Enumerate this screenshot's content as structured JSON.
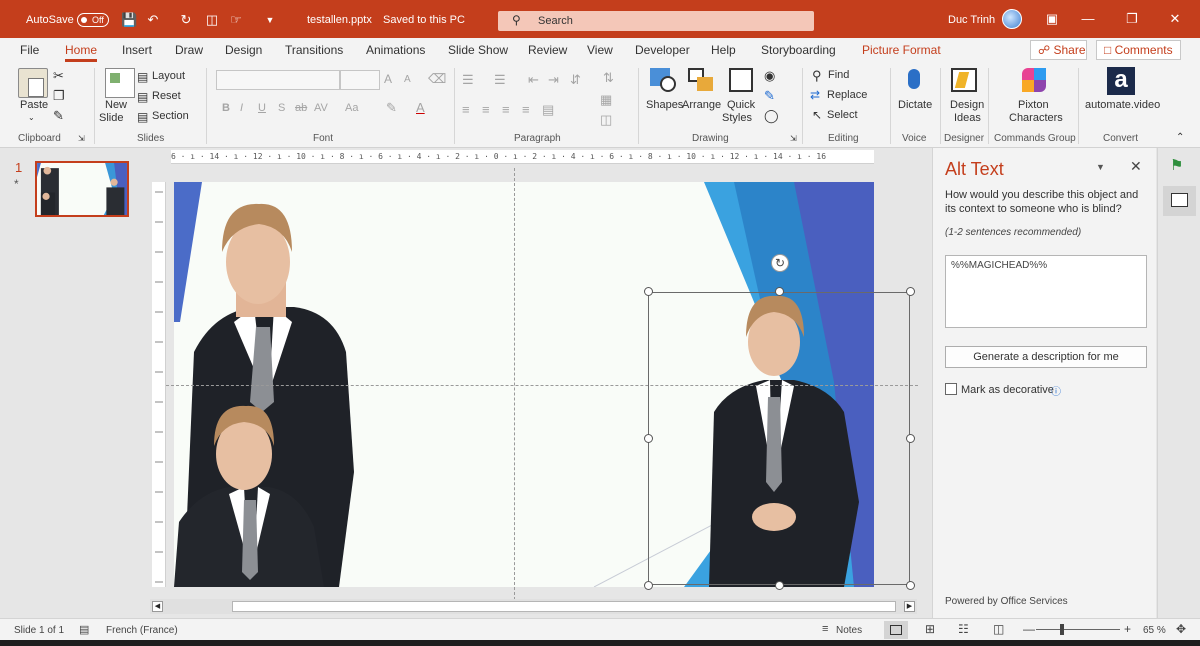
{
  "titlebar": {
    "autosave_label": "AutoSave",
    "toggle_state": "Off",
    "filename": "testallen.pptx",
    "save_status": "Saved to this PC",
    "search_placeholder": "Search",
    "user_name": "Duc Trinh",
    "accent": "#c43e1c"
  },
  "tabs": [
    "File",
    "Home",
    "Insert",
    "Draw",
    "Design",
    "Transitions",
    "Animations",
    "Slide Show",
    "Review",
    "View",
    "Developer",
    "Help",
    "Storyboarding",
    "Picture Format"
  ],
  "active_tab": "Home",
  "share": {
    "share_label": "Share",
    "comments_label": "Comments"
  },
  "ribbon": {
    "clipboard": {
      "paste": "Paste",
      "group": "Clipboard"
    },
    "slides": {
      "new_slide_1": "New",
      "new_slide_2": "Slide",
      "layout": "Layout",
      "reset": "Reset",
      "section": "Section",
      "group": "Slides"
    },
    "font": {
      "group": "Font",
      "bold": "B",
      "italic": "I",
      "underline": "U",
      "shadow": "S",
      "strike": "ab",
      "spacing": "AV",
      "case": "Aa",
      "grow": "A",
      "shrink": "A"
    },
    "paragraph": {
      "group": "Paragraph"
    },
    "drawing": {
      "shapes": "Shapes",
      "arrange": "Arrange",
      "quick_styles_1": "Quick",
      "quick_styles_2": "Styles",
      "group": "Drawing"
    },
    "editing": {
      "find": "Find",
      "replace": "Replace",
      "select": "Select",
      "group": "Editing"
    },
    "voice": {
      "dictate": "Dictate",
      "group": "Voice"
    },
    "designer": {
      "design_ideas_1": "Design",
      "design_ideas_2": "Ideas",
      "group": "Designer"
    },
    "commands": {
      "pixton_1": "Pixton",
      "pixton_2": "Characters",
      "group": "Commands Group"
    },
    "convert": {
      "automate": "automate.video",
      "group": "Convert"
    }
  },
  "slides_panel": {
    "slide_number": "1",
    "star": "*"
  },
  "ruler": {
    "horizontal": "6 · ı · 14 · ı · 12 · ı · 10 · ı · 8 · ı · 6 · ı · 4 · ı · 2 · ı · 0 · ı · 2 · ı · 4 · ı · 6 · ı · 8 · ı · 10 · ı · 12 · ı · 14 · ı · 16"
  },
  "alt_text": {
    "title": "Alt Text",
    "prompt": "How would you describe this object and its context to someone who is blind?",
    "hint": "(1-2 sentences recommended)",
    "value": "%%MAGICHEAD%%",
    "generate_btn": "Generate a description for me",
    "decorative_label": "Mark as decorative",
    "powered_by": "Powered by Office Services"
  },
  "status": {
    "slide_info": "Slide 1 of 1",
    "language": "French (France)",
    "notes": "Notes",
    "zoom": "65 %"
  }
}
